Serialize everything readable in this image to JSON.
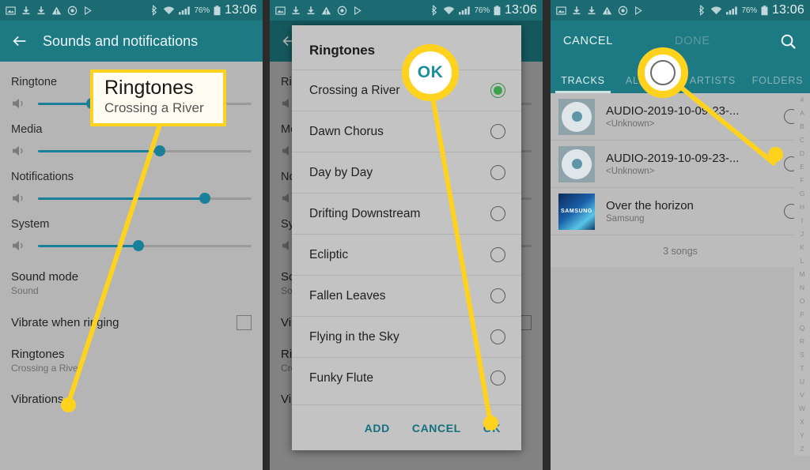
{
  "status_bar": {
    "left_icons": [
      "screenshot-icon",
      "download-icon",
      "download-icon",
      "warning-icon",
      "sync-icon",
      "play-store-icon"
    ],
    "bluetooth": "bluetooth-icon",
    "wifi": "wifi-icon",
    "signal": "signal-icon",
    "battery_percent": "76%",
    "battery": "battery-icon",
    "clock": "13:06"
  },
  "panel1": {
    "appbar": {
      "back": "back-arrow-icon",
      "title": "Sounds and notifications"
    },
    "sliders": [
      {
        "label": "Ringtone",
        "value": 25
      },
      {
        "label": "Media",
        "value": 57
      },
      {
        "label": "Notifications",
        "value": 78
      },
      {
        "label": "System",
        "value": 47
      }
    ],
    "items": [
      {
        "title": "Sound mode",
        "sub": "Sound",
        "control": "none"
      },
      {
        "title": "Vibrate when ringing",
        "sub": "",
        "control": "checkbox"
      },
      {
        "title": "Ringtones",
        "sub": "Crossing a River",
        "control": "none"
      },
      {
        "title": "Vibrations",
        "sub": "",
        "control": "none"
      }
    ]
  },
  "panel2": {
    "dialog": {
      "title": "Ringtones",
      "options": [
        {
          "name": "Crossing a River",
          "selected": true
        },
        {
          "name": "Dawn Chorus",
          "selected": false
        },
        {
          "name": "Day by Day",
          "selected": false
        },
        {
          "name": "Drifting Downstream",
          "selected": false
        },
        {
          "name": "Ecliptic",
          "selected": false
        },
        {
          "name": "Fallen Leaves",
          "selected": false
        },
        {
          "name": "Flying in the Sky",
          "selected": false
        },
        {
          "name": "Funky Flute",
          "selected": false
        }
      ],
      "actions": {
        "add": "ADD",
        "cancel": "CANCEL",
        "ok": "OK"
      }
    }
  },
  "panel3": {
    "appbar": {
      "cancel": "CANCEL",
      "done": "DONE",
      "search": "search-icon"
    },
    "tabs": [
      {
        "label": "TRACKS",
        "active": true
      },
      {
        "label": "ALBUMS",
        "active": false
      },
      {
        "label": "ARTISTS",
        "active": false
      },
      {
        "label": "FOLDERS",
        "active": false
      }
    ],
    "tracks": [
      {
        "title": "AUDIO-2019-10-09-23-...",
        "artist": "<Unknown>",
        "art": "cd-art",
        "selected": false
      },
      {
        "title": "AUDIO-2019-10-09-23-...",
        "artist": "<Unknown>",
        "art": "cd-art",
        "selected": false
      },
      {
        "title": "Over the horizon",
        "artist": "Samsung",
        "art": "samsung-art",
        "art_label": "SAMSUNG",
        "selected": false
      }
    ],
    "songs_count": "3 songs",
    "alpha_index": [
      "#",
      "A",
      "B",
      "C",
      "D",
      "E",
      "F",
      "G",
      "H",
      "I",
      "J",
      "K",
      "L",
      "M",
      "N",
      "O",
      "P",
      "Q",
      "R",
      "S",
      "T",
      "U",
      "V",
      "W",
      "X",
      "Y",
      "Z"
    ]
  },
  "callouts": {
    "ringtones_box": {
      "title": "Ringtones",
      "sub": "Crossing a River"
    },
    "ok_bubble": "OK"
  },
  "colors": {
    "status_bar": "#1d6b72",
    "app_bar": "#1d7a82",
    "accent_teal": "#14707e",
    "slider_fill": "#1a7f98",
    "callout_yellow": "#ffd21e",
    "radio_selected": "#3ea14f",
    "page_bg": "#b5b5b5"
  }
}
